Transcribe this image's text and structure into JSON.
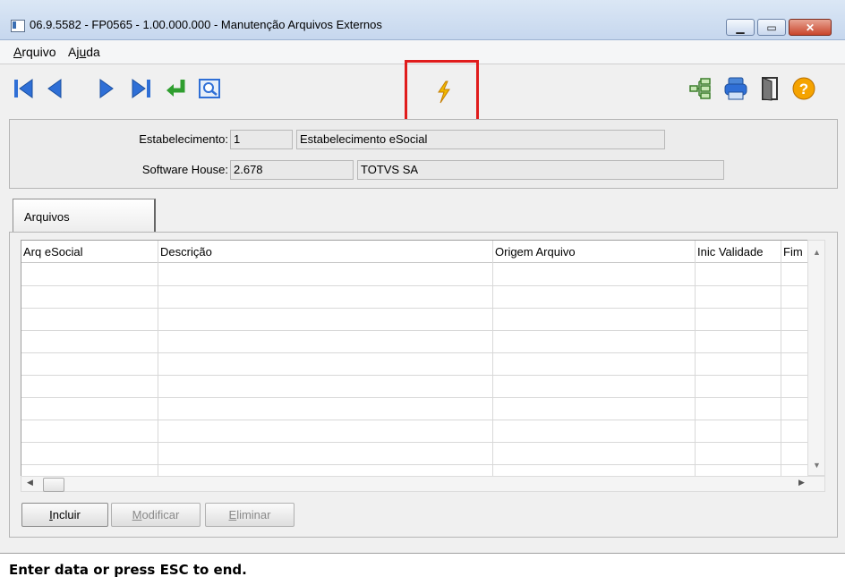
{
  "window": {
    "title": "06.9.5582 - FP0565 - 1.00.000.000 - Manutenção Arquivos Externos"
  },
  "menu": [
    {
      "label": "Arquivo"
    },
    {
      "label": "Ajuda"
    }
  ],
  "toolbar": {
    "left_icons": [
      "first-record-icon",
      "prev-record-icon",
      "next-record-icon",
      "last-record-icon",
      "goto-icon",
      "search-zoom-icon"
    ],
    "center_icon": "lightning-icon",
    "right_icons": [
      "tree-structure-icon",
      "print-icon",
      "exit-door-icon",
      "help-icon"
    ],
    "highlight_color": "#e01c1c"
  },
  "header": {
    "estabelecimento": {
      "label": "Estabelecimento:",
      "code": "1",
      "name": "Estabelecimento eSocial"
    },
    "software_house": {
      "label": "Software House:",
      "code": "2.678",
      "name": "TOTVS SA"
    }
  },
  "tabs": [
    {
      "label": "Arquivos"
    }
  ],
  "grid": {
    "columns": [
      "Arq eSocial",
      "Descrição",
      "Origem Arquivo",
      "Inic Validade",
      "Fim"
    ],
    "rows": []
  },
  "buttons": {
    "incluir": "Incluir",
    "modificar": "Modificar",
    "eliminar": "Eliminar"
  },
  "status": {
    "text": "Enter data or press ESC to end."
  }
}
